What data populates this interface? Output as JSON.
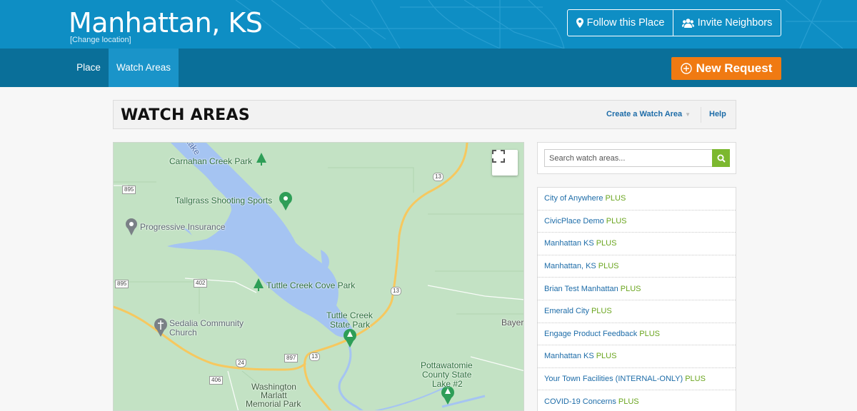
{
  "header": {
    "place_title": "Manhattan, KS",
    "change_location": "[Change location]",
    "follow_label": "Follow this Place",
    "invite_label": "Invite Neighbors"
  },
  "nav": {
    "items": [
      {
        "label": "Place"
      },
      {
        "label": "Watch Areas",
        "active": true
      }
    ],
    "new_request_label": "New Request"
  },
  "panel": {
    "title": "WATCH AREAS",
    "create_label": "Create a Watch Area",
    "help_label": "Help"
  },
  "map": {
    "labels": {
      "carnahan": "Carnahan Creek Park",
      "tallgrass": "Tallgrass Shooting Sports",
      "progressive": "Progressive Insurance",
      "tuttle_cove": "Tuttle Creek Cove Park",
      "tuttle_state_1": "Tuttle Creek",
      "tuttle_state_2": "State Park",
      "sedalia_1": "Sedalia Community",
      "sedalia_2": "Church",
      "bayer": "Bayer",
      "pottawatomie_1": "Pottawatomie",
      "pottawatomie_2": "County State",
      "pottawatomie_3": "Lake #2",
      "washington_1": "Washington",
      "washington_2": "Marlatt",
      "washington_3": "Memorial Park",
      "lake": "Lake"
    },
    "shields": {
      "r895a": "895",
      "r895b": "895",
      "r402": "402",
      "r13a": "13",
      "r13b": "13",
      "r13c": "13",
      "r24": "24",
      "r897": "897",
      "r406": "406"
    },
    "colors": {
      "land": "#c3e2c4",
      "water": "#a5c4f2",
      "highway": "#f6c85f",
      "poi_green": "#2e9e57"
    }
  },
  "sidebar": {
    "search_placeholder": "Search watch areas...",
    "items": [
      {
        "name": "City of Anywhere",
        "badge": "PLUS"
      },
      {
        "name": "CivicPlace Demo",
        "badge": "PLUS"
      },
      {
        "name": "Manhattan KS",
        "badge": "PLUS"
      },
      {
        "name": "Manhattan, KS",
        "badge": "PLUS"
      },
      {
        "name": "Brian Test Manhattan",
        "badge": "PLUS"
      },
      {
        "name": "Emerald City",
        "badge": "PLUS"
      },
      {
        "name": "Engage Product Feedback",
        "badge": "PLUS"
      },
      {
        "name": "Manhattan KS",
        "badge": "PLUS"
      },
      {
        "name": "Your Town Facilities (INTERNAL-ONLY)",
        "badge": "PLUS"
      },
      {
        "name": "COVID-19 Concerns",
        "badge": "PLUS"
      }
    ]
  }
}
